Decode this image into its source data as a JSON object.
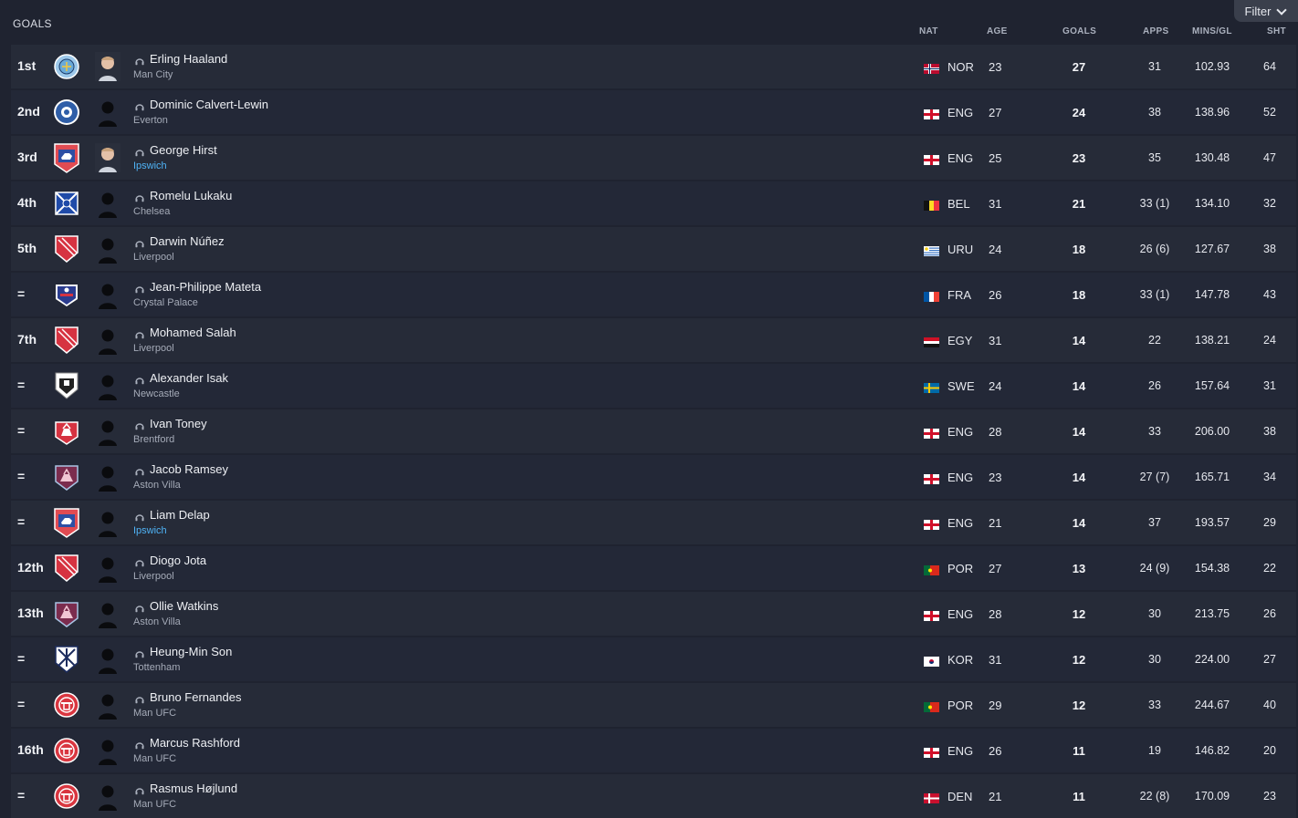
{
  "title": "GOALS",
  "filter": {
    "label": "Filter",
    "icon": "chevron-down-icon"
  },
  "columns": {
    "nat": "NAT",
    "age": "AGE",
    "goals": "GOALS",
    "apps": "APPS",
    "mins_per_goal": "MINS/GL",
    "shots": "SHT"
  },
  "colors": {
    "link": "#4fb3f6",
    "background": "#1f2330",
    "row_odd": "#262b38",
    "row_even": "#232837"
  },
  "rows": [
    {
      "rank": "1st",
      "name": "Erling Haaland",
      "club": "Man City",
      "club_link": false,
      "crest": "man-city-crest",
      "avatar": "photo",
      "nat": "NOR",
      "flag": "flag-nor",
      "age": "23",
      "goals": "27",
      "apps": "31",
      "mins_per_goal": "102.93",
      "shots": "64"
    },
    {
      "rank": "2nd",
      "name": "Dominic Calvert-Lewin",
      "club": "Everton",
      "club_link": false,
      "crest": "everton-crest",
      "avatar": "silhouette",
      "nat": "ENG",
      "flag": "flag-eng",
      "age": "27",
      "goals": "24",
      "apps": "38",
      "mins_per_goal": "138.96",
      "shots": "52"
    },
    {
      "rank": "3rd",
      "name": "George Hirst",
      "club": "Ipswich",
      "club_link": true,
      "crest": "ipswich-crest",
      "avatar": "photo",
      "nat": "ENG",
      "flag": "flag-eng",
      "age": "25",
      "goals": "23",
      "apps": "35",
      "mins_per_goal": "130.48",
      "shots": "47"
    },
    {
      "rank": "4th",
      "name": "Romelu Lukaku",
      "club": "Chelsea",
      "club_link": false,
      "crest": "chelsea-crest",
      "avatar": "silhouette",
      "nat": "BEL",
      "flag": "flag-bel",
      "age": "31",
      "goals": "21",
      "apps": "33 (1)",
      "mins_per_goal": "134.10",
      "shots": "32"
    },
    {
      "rank": "5th",
      "name": "Darwin Núñez",
      "club": "Liverpool",
      "club_link": false,
      "crest": "liverpool-crest",
      "avatar": "silhouette",
      "nat": "URU",
      "flag": "flag-uru",
      "age": "24",
      "goals": "18",
      "apps": "26 (6)",
      "mins_per_goal": "127.67",
      "shots": "38"
    },
    {
      "rank": "=",
      "name": "Jean-Philippe Mateta",
      "club": "Crystal Palace",
      "club_link": false,
      "crest": "crystal-palace-crest",
      "avatar": "silhouette",
      "nat": "FRA",
      "flag": "flag-fra",
      "age": "26",
      "goals": "18",
      "apps": "33 (1)",
      "mins_per_goal": "147.78",
      "shots": "43"
    },
    {
      "rank": "7th",
      "name": "Mohamed Salah",
      "club": "Liverpool",
      "club_link": false,
      "crest": "liverpool-crest",
      "avatar": "silhouette",
      "nat": "EGY",
      "flag": "flag-egy",
      "age": "31",
      "goals": "14",
      "apps": "22",
      "mins_per_goal": "138.21",
      "shots": "24"
    },
    {
      "rank": "=",
      "name": "Alexander Isak",
      "club": "Newcastle",
      "club_link": false,
      "crest": "newcastle-crest",
      "avatar": "silhouette",
      "nat": "SWE",
      "flag": "flag-swe",
      "age": "24",
      "goals": "14",
      "apps": "26",
      "mins_per_goal": "157.64",
      "shots": "31"
    },
    {
      "rank": "=",
      "name": "Ivan Toney",
      "club": "Brentford",
      "club_link": false,
      "crest": "brentford-crest",
      "avatar": "silhouette",
      "nat": "ENG",
      "flag": "flag-eng",
      "age": "28",
      "goals": "14",
      "apps": "33",
      "mins_per_goal": "206.00",
      "shots": "38"
    },
    {
      "rank": "=",
      "name": "Jacob Ramsey",
      "club": "Aston Villa",
      "club_link": false,
      "crest": "aston-villa-crest",
      "avatar": "silhouette",
      "nat": "ENG",
      "flag": "flag-eng",
      "age": "23",
      "goals": "14",
      "apps": "27 (7)",
      "mins_per_goal": "165.71",
      "shots": "34"
    },
    {
      "rank": "=",
      "name": "Liam Delap",
      "club": "Ipswich",
      "club_link": true,
      "crest": "ipswich-crest",
      "avatar": "silhouette",
      "nat": "ENG",
      "flag": "flag-eng",
      "age": "21",
      "goals": "14",
      "apps": "37",
      "mins_per_goal": "193.57",
      "shots": "29"
    },
    {
      "rank": "12th",
      "name": "Diogo Jota",
      "club": "Liverpool",
      "club_link": false,
      "crest": "liverpool-crest",
      "avatar": "silhouette",
      "nat": "POR",
      "flag": "flag-por",
      "age": "27",
      "goals": "13",
      "apps": "24 (9)",
      "mins_per_goal": "154.38",
      "shots": "22"
    },
    {
      "rank": "13th",
      "name": "Ollie Watkins",
      "club": "Aston Villa",
      "club_link": false,
      "crest": "aston-villa-crest",
      "avatar": "silhouette",
      "nat": "ENG",
      "flag": "flag-eng",
      "age": "28",
      "goals": "12",
      "apps": "30",
      "mins_per_goal": "213.75",
      "shots": "26"
    },
    {
      "rank": "=",
      "name": "Heung-Min Son",
      "club": "Tottenham",
      "club_link": false,
      "crest": "tottenham-crest",
      "avatar": "silhouette",
      "nat": "KOR",
      "flag": "flag-kor",
      "age": "31",
      "goals": "12",
      "apps": "30",
      "mins_per_goal": "224.00",
      "shots": "27"
    },
    {
      "rank": "=",
      "name": "Bruno Fernandes",
      "club": "Man UFC",
      "club_link": false,
      "crest": "man-ufc-crest",
      "avatar": "silhouette",
      "nat": "POR",
      "flag": "flag-por",
      "age": "29",
      "goals": "12",
      "apps": "33",
      "mins_per_goal": "244.67",
      "shots": "40"
    },
    {
      "rank": "16th",
      "name": "Marcus Rashford",
      "club": "Man UFC",
      "club_link": false,
      "crest": "man-ufc-crest",
      "avatar": "silhouette",
      "nat": "ENG",
      "flag": "flag-eng",
      "age": "26",
      "goals": "11",
      "apps": "19",
      "mins_per_goal": "146.82",
      "shots": "20"
    },
    {
      "rank": "=",
      "name": "Rasmus Højlund",
      "club": "Man UFC",
      "club_link": false,
      "crest": "man-ufc-crest",
      "avatar": "silhouette",
      "nat": "DEN",
      "flag": "flag-den",
      "age": "21",
      "goals": "11",
      "apps": "22 (8)",
      "mins_per_goal": "170.09",
      "shots": "23"
    }
  ]
}
